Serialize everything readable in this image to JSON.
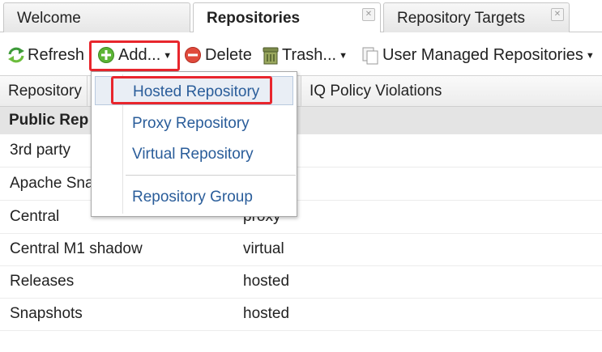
{
  "tabs": [
    {
      "label": "Welcome"
    },
    {
      "label": "Repositories"
    },
    {
      "label": "Repository Targets"
    }
  ],
  "toolbar": {
    "refresh_label": "Refresh",
    "add_label": "Add...",
    "delete_label": "Delete",
    "trash_label": "Trash...",
    "user_managed_label": "User Managed Repositories"
  },
  "columns": [
    "Repository",
    "IQ Policy Violations"
  ],
  "group_label": "Public Rep",
  "rows": [
    {
      "name": "3rd party",
      "type": ""
    },
    {
      "name": "Apache Sna",
      "type": ""
    },
    {
      "name": "Central",
      "type": "proxy"
    },
    {
      "name": "Central M1 shadow",
      "type": "virtual"
    },
    {
      "name": "Releases",
      "type": "hosted"
    },
    {
      "name": "Snapshots",
      "type": "hosted"
    }
  ],
  "add_menu": {
    "items": [
      "Hosted Repository",
      "Proxy Repository",
      "Virtual Repository",
      "Repository Group"
    ]
  },
  "colors": {
    "highlight": "#e8262d",
    "menu_link": "#2a5d9a",
    "group_bg": "#e4e4e4"
  },
  "icons": [
    "close-icon",
    "refresh-icon",
    "add-icon",
    "delete-icon",
    "trash-icon",
    "user-managed-icon"
  ]
}
